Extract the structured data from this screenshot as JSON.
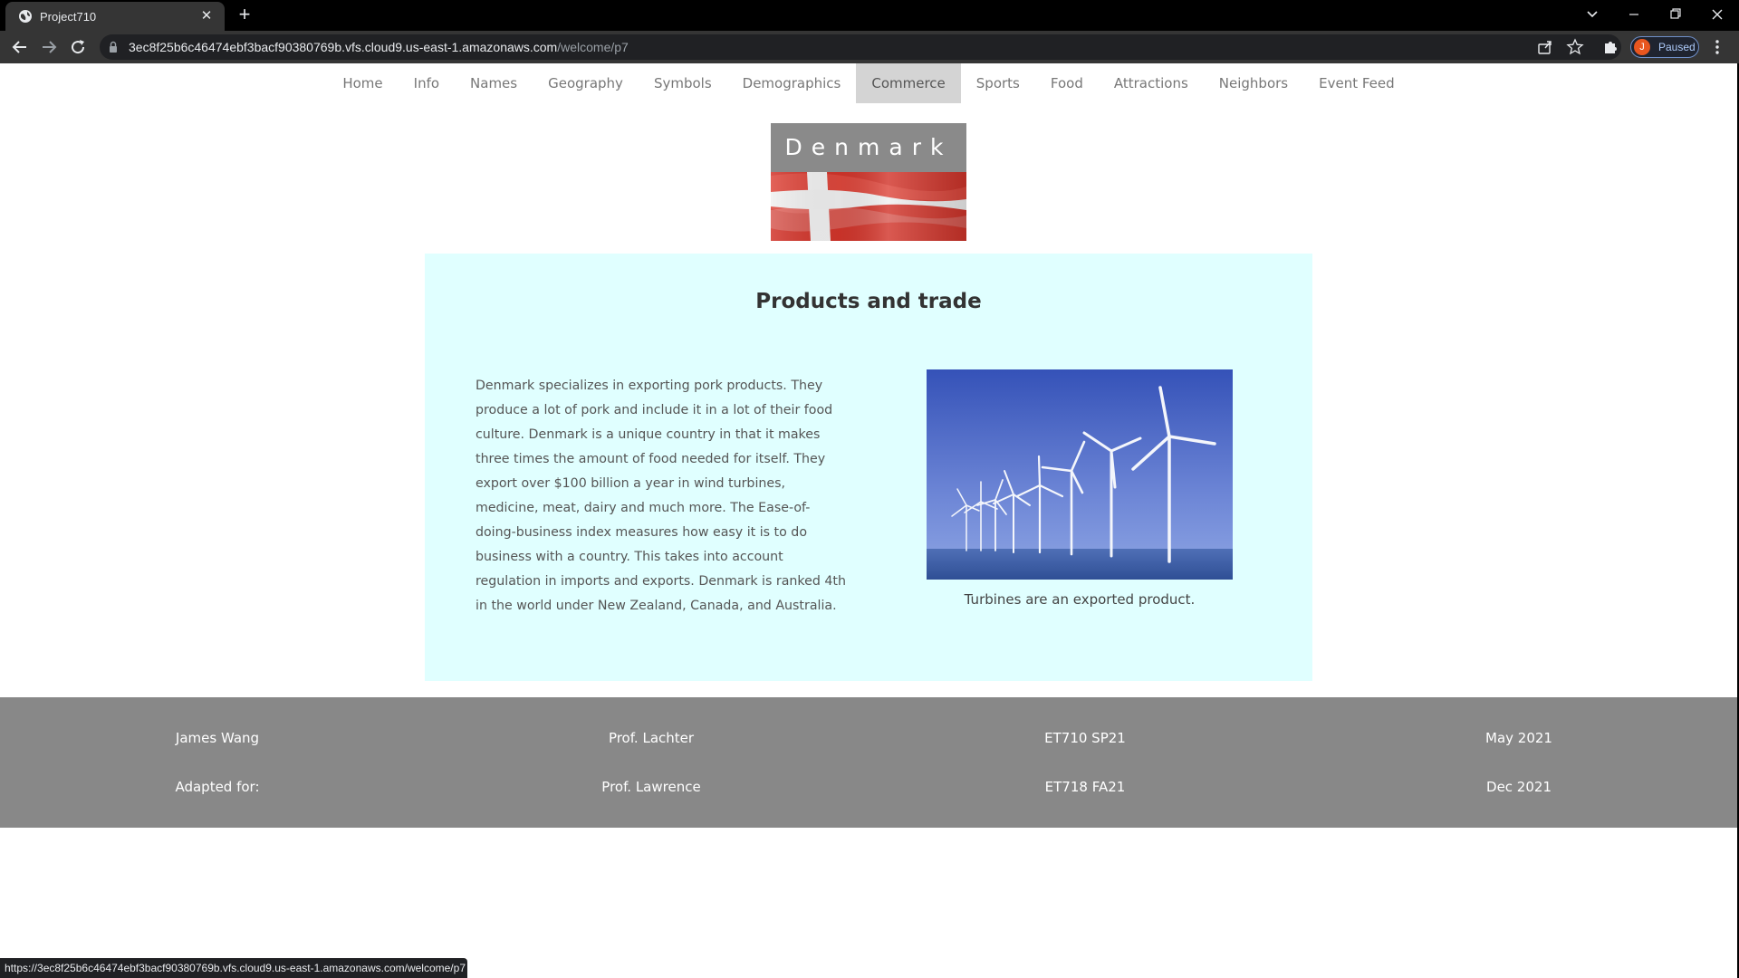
{
  "browser": {
    "tab_title": "Project710",
    "url_host": "3ec8f25b6c46474ebf3bacf90380769b.vfs.cloud9.us-east-1.amazonaws.com",
    "url_path": "/welcome/p7",
    "profile_initial": "J",
    "profile_state": "Paused",
    "status_url": "https://3ec8f25b6c46474ebf3bacf90380769b.vfs.cloud9.us-east-1.amazonaws.com/welcome/p7"
  },
  "nav": {
    "items": [
      "Home",
      "Info",
      "Names",
      "Geography",
      "Symbols",
      "Demographics",
      "Commerce",
      "Sports",
      "Food",
      "Attractions",
      "Neighbors",
      "Event Feed"
    ],
    "active": "Commerce"
  },
  "brand": {
    "title": "Denmark"
  },
  "content": {
    "heading": "Products and trade",
    "paragraph": "Denmark specializes in exporting pork products. They produce a lot of pork and include it in a lot of their food culture. Denmark is a unique country in that it makes three times the amount of food needed for itself. They export over $100 billion a year in wind turbines, medicine, meat, dairy and much more. The Ease-of-doing-business index measures how easy it is to do business with a country. This takes into account regulation in imports and exports. Denmark is ranked 4th in the world under New Zealand, Canada, and Australia.",
    "caption": "Turbines are an exported product."
  },
  "footer": {
    "row1": [
      "James Wang",
      "Prof. Lachter",
      "ET710 SP21",
      "May 2021"
    ],
    "row2": [
      "Adapted for:",
      "Prof. Lawrence",
      "ET718 FA21",
      "Dec 2021"
    ]
  },
  "colors": {
    "content_bg": "#e0ffff",
    "footer_bg": "#888888",
    "nav_active_bg": "#d4d4d4",
    "flag_red": "#c8102e"
  }
}
